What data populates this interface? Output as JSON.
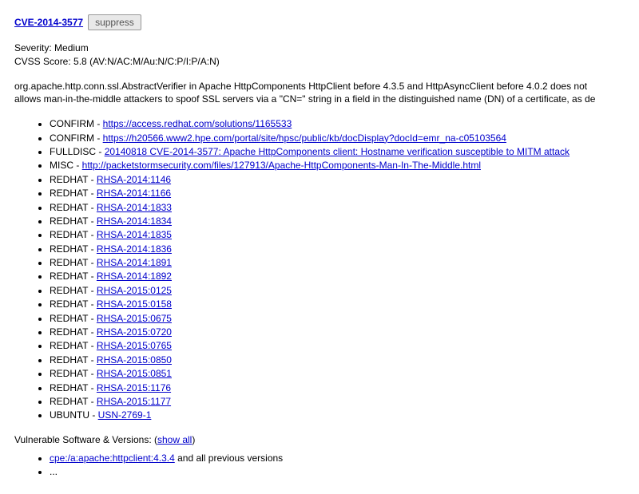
{
  "cve_id": "CVE-2014-3577",
  "suppress_label": "suppress",
  "severity_label": "Severity:",
  "severity_value": "Medium",
  "cvss_label": "CVSS Score:",
  "cvss_value": "5.8 (AV:N/AC:M/Au:N/C:P/I:P/A:N)",
  "description_line1": "org.apache.http.conn.ssl.AbstractVerifier in Apache HttpComponents HttpClient before 4.3.5 and HttpAsyncClient before 4.0.2 does not",
  "description_line2": "allows man-in-the-middle attackers to spoof SSL servers via a \"CN=\" string in a field in the distinguished name (DN) of a certificate, as de",
  "references": [
    {
      "source": "CONFIRM",
      "text": "https://access.redhat.com/solutions/1165533"
    },
    {
      "source": "CONFIRM",
      "text": "https://h20566.www2.hpe.com/portal/site/hpsc/public/kb/docDisplay?docId=emr_na-c05103564"
    },
    {
      "source": "FULLDISC",
      "text": "20140818 CVE-2014-3577: Apache HttpComponents client: Hostname verification susceptible to MITM attack"
    },
    {
      "source": "MISC",
      "text": "http://packetstormsecurity.com/files/127913/Apache-HttpComponents-Man-In-The-Middle.html"
    },
    {
      "source": "REDHAT",
      "text": "RHSA-2014:1146"
    },
    {
      "source": "REDHAT",
      "text": "RHSA-2014:1166"
    },
    {
      "source": "REDHAT",
      "text": "RHSA-2014:1833"
    },
    {
      "source": "REDHAT",
      "text": "RHSA-2014:1834"
    },
    {
      "source": "REDHAT",
      "text": "RHSA-2014:1835"
    },
    {
      "source": "REDHAT",
      "text": "RHSA-2014:1836"
    },
    {
      "source": "REDHAT",
      "text": "RHSA-2014:1891"
    },
    {
      "source": "REDHAT",
      "text": "RHSA-2014:1892"
    },
    {
      "source": "REDHAT",
      "text": "RHSA-2015:0125"
    },
    {
      "source": "REDHAT",
      "text": "RHSA-2015:0158"
    },
    {
      "source": "REDHAT",
      "text": "RHSA-2015:0675"
    },
    {
      "source": "REDHAT",
      "text": "RHSA-2015:0720"
    },
    {
      "source": "REDHAT",
      "text": "RHSA-2015:0765"
    },
    {
      "source": "REDHAT",
      "text": "RHSA-2015:0850"
    },
    {
      "source": "REDHAT",
      "text": "RHSA-2015:0851"
    },
    {
      "source": "REDHAT",
      "text": "RHSA-2015:1176"
    },
    {
      "source": "REDHAT",
      "text": "RHSA-2015:1177"
    },
    {
      "source": "UBUNTU",
      "text": "USN-2769-1"
    }
  ],
  "vuln_header": "Vulnerable Software & Versions: (",
  "show_all": "show all",
  "vuln_header_close": ")",
  "cpes": [
    {
      "id": "cpe:/a:apache:httpclient:4.3.4",
      "suffix": " and all previous versions"
    },
    {
      "id": "...",
      "suffix": ""
    }
  ]
}
